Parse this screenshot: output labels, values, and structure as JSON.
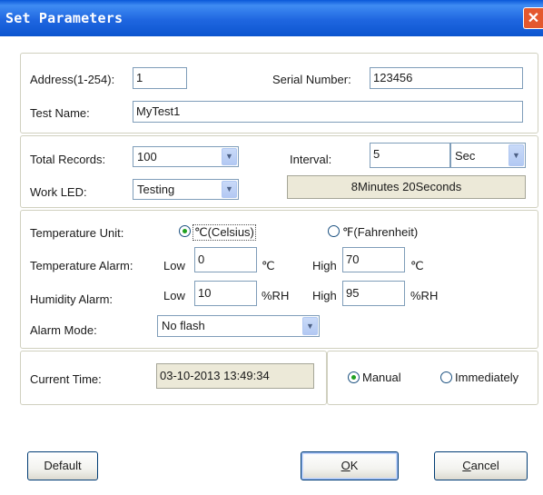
{
  "window": {
    "title": "Set Parameters",
    "close_glyph": "✕"
  },
  "device": {
    "address_label": "Address(1-254):",
    "address_value": "1",
    "serial_label": "Serial Number:",
    "serial_value": "123456",
    "test_name_label": "Test Name:",
    "test_name_value": "MyTest1"
  },
  "records": {
    "total_records_label": "Total Records:",
    "total_records_value": "100",
    "interval_label": "Interval:",
    "interval_value": "5",
    "interval_unit": "Sec",
    "work_led_label": "Work LED:",
    "work_led_value": "Testing",
    "duration_text": "8Minutes 20Seconds"
  },
  "alarms": {
    "temp_unit_label": "Temperature Unit:",
    "celsius_label": "℃(Celsius)",
    "fahrenheit_label": "℉(Fahrenheit)",
    "temp_unit_selected": "celsius",
    "temp_alarm_label": "Temperature Alarm:",
    "temp_low_label": "Low",
    "temp_low_value": "0",
    "temp_low_unit": "℃",
    "temp_high_label": "High",
    "temp_high_value": "70",
    "temp_high_unit": "℃",
    "hum_alarm_label": "Humidity Alarm:",
    "hum_low_label": "Low",
    "hum_low_value": "10",
    "hum_low_unit": "%RH",
    "hum_high_label": "High",
    "hum_high_value": "95",
    "hum_high_unit": "%RH",
    "alarm_mode_label": "Alarm Mode:",
    "alarm_mode_value": "No flash"
  },
  "time": {
    "current_time_label": "Current Time:",
    "current_time_value": "03-10-2013 13:49:34",
    "manual_label": "Manual",
    "immediately_label": "Immediately",
    "selected": "manual"
  },
  "buttons": {
    "default_label": "Default",
    "ok_mnemonic": "O",
    "ok_rest": "K",
    "cancel_mnemonic": "C",
    "cancel_rest": "ancel"
  },
  "icons": {
    "dropdown": "chevron-down-icon",
    "close": "close-icon"
  },
  "colors": {
    "titlebar": "#1f66e0",
    "close_button": "#e4582e",
    "radio_dot": "#21a121"
  }
}
